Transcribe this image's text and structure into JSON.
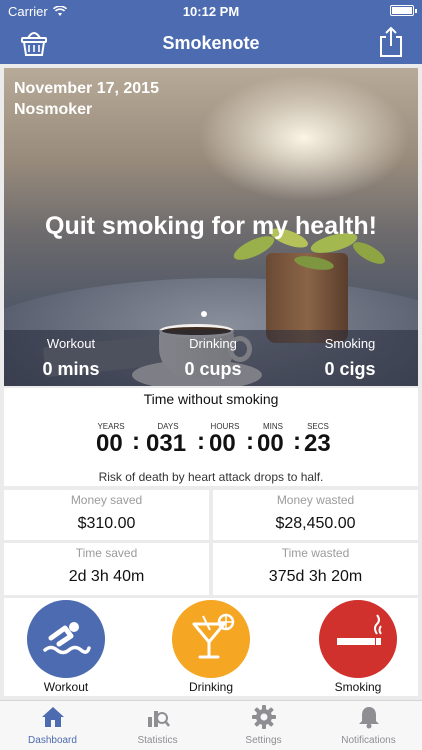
{
  "status_bar": {
    "carrier": "Carrier",
    "time": "10:12 PM"
  },
  "nav": {
    "title": "Smokenote",
    "left_icon": "basket-icon",
    "right_icon": "share-icon"
  },
  "hero": {
    "date": "November 17, 2015",
    "username": "Nosmoker",
    "motto": "Quit smoking for my health!",
    "stats": [
      {
        "label": "Workout",
        "value": "0 mins"
      },
      {
        "label": "Drinking",
        "value": "0 cups"
      },
      {
        "label": "Smoking",
        "value": "0 cigs"
      }
    ]
  },
  "timer": {
    "heading": "Time without smoking",
    "units": [
      "YEARS",
      "DAYS",
      "HOURS",
      "MINS",
      "SECS"
    ],
    "values": [
      "00",
      "031",
      "00",
      "00",
      "23"
    ],
    "message": "Risk of death by heart attack drops to half."
  },
  "summary": {
    "money_saved_label": "Money saved",
    "money_saved": "$310.00",
    "money_wasted_label": "Money wasted",
    "money_wasted": "$28,450.00",
    "time_saved_label": "Time saved",
    "time_saved": "2d 3h 40m",
    "time_wasted_label": "Time wasted",
    "time_wasted": "375d 3h 20m"
  },
  "actions": [
    {
      "label": "Workout",
      "icon": "swimmer-icon",
      "color": "#4d6bb0"
    },
    {
      "label": "Drinking",
      "icon": "cocktail-icon",
      "color": "#f5a623"
    },
    {
      "label": "Smoking",
      "icon": "cigarette-icon",
      "color": "#d0312d"
    }
  ],
  "tabs": [
    {
      "label": "Dashboard",
      "icon": "home-icon",
      "active": true
    },
    {
      "label": "Statistics",
      "icon": "statistics-icon",
      "active": false
    },
    {
      "label": "Settings",
      "icon": "gear-icon",
      "active": false
    },
    {
      "label": "Notifications",
      "icon": "bell-icon",
      "active": false
    }
  ],
  "colors": {
    "brand": "#4d6bb0",
    "tab_inactive": "#8e8e93"
  }
}
